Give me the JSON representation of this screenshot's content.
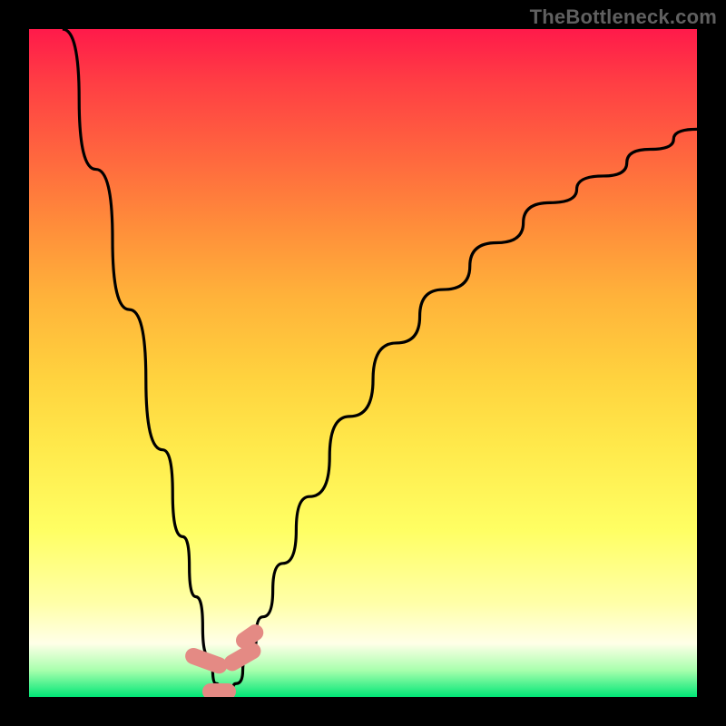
{
  "watermark": "TheBottleneck.com",
  "colors": {
    "gradient_top": "#ff1a4a",
    "gradient_mid": "#ffe84a",
    "gradient_bottom": "#00e676",
    "curve": "#000000",
    "marker": "#e48a84",
    "frame": "#000000"
  },
  "chart_data": {
    "type": "line",
    "title": "",
    "xlabel": "",
    "ylabel": "",
    "xlim": [
      0,
      100
    ],
    "ylim": [
      0,
      100
    ],
    "grid": false,
    "legend": false,
    "annotations": [
      "TheBottleneck.com"
    ],
    "notes": "V-shaped bottleneck curve. Minimum (~0) near x≈28–31. Left branch reaches y=100 at x≈5; right branch reaches y≈85 at x=100. Values estimated from pixels; axes are unlabeled in source image.",
    "series": [
      {
        "name": "bottleneck-curve",
        "x": [
          5,
          10,
          15,
          20,
          23,
          25,
          27,
          28,
          29,
          30,
          31,
          33,
          35,
          38,
          42,
          48,
          55,
          62,
          70,
          78,
          86,
          93,
          100
        ],
        "values": [
          100,
          79,
          58,
          37,
          24,
          15,
          6,
          2,
          0,
          0,
          2,
          6,
          12,
          20,
          30,
          42,
          53,
          61,
          68,
          74,
          78,
          82,
          85
        ]
      }
    ],
    "markers": [
      {
        "name": "left-lobe",
        "x": 26.5,
        "y": 5.5,
        "w": 2.5,
        "h": 6.5,
        "angle": -70
      },
      {
        "name": "right-lobe",
        "x": 32.0,
        "y": 6.0,
        "w": 2.5,
        "h": 6.0,
        "angle": 60
      },
      {
        "name": "right-lobe-2",
        "x": 33.0,
        "y": 9.0,
        "w": 2.5,
        "h": 4.5,
        "angle": 55
      },
      {
        "name": "bottom-lobe",
        "x": 28.5,
        "y": 0.8,
        "w": 5.0,
        "h": 2.5,
        "angle": 0
      }
    ]
  }
}
